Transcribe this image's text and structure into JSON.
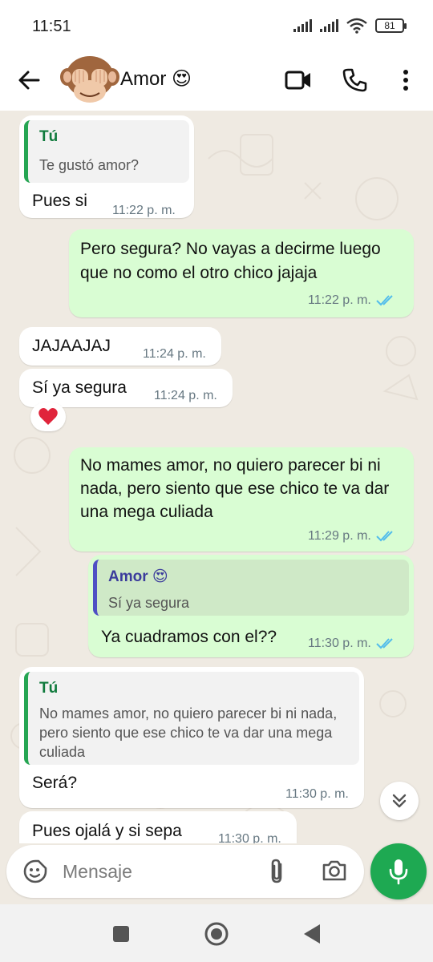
{
  "status_bar": {
    "time": "11:51",
    "battery": "81"
  },
  "header": {
    "contact_name": "Amor 😍"
  },
  "messages": [
    {
      "dir": "in",
      "quote_name": "Tú",
      "quote_text": "Te gustó amor?",
      "text": "Pues si",
      "time": "11:22 p. m."
    },
    {
      "dir": "out",
      "text": "Pero segura? No vayas a decirme luego que no como el otro chico jajaja",
      "time": "11:22 p. m.",
      "read": true
    },
    {
      "dir": "in",
      "text": "JAJAAJAJ",
      "time": "11:24 p. m."
    },
    {
      "dir": "in",
      "text": "Sí ya segura",
      "time": "11:24 p. m.",
      "reaction": "❤️"
    },
    {
      "dir": "out",
      "text": "No mames amor, no quiero parecer bi ni nada, pero siento que ese chico te va dar una mega culiada",
      "time": "11:29 p. m.",
      "read": true
    },
    {
      "dir": "out",
      "quote_name": "Amor 😍",
      "quote_text": "Sí ya segura",
      "text": "Ya cuadramos con el??",
      "time": "11:30 p. m.",
      "read": true
    },
    {
      "dir": "in",
      "quote_name": "Tú",
      "quote_text": "No mames amor, no quiero parecer bi ni nada, pero siento que ese chico te va dar una mega culiada",
      "text": "Será?",
      "time": "11:30 p. m."
    },
    {
      "dir": "in",
      "text": "Pues ojalá y si sepa",
      "time": "11:30 p. m."
    }
  ],
  "composer": {
    "placeholder": "Mensaje"
  },
  "colors": {
    "accent": "#1ea952",
    "outgoing_bubble": "#d9fdd3",
    "chat_bg": "#efeae2",
    "read_ticks": "#53bdeb"
  },
  "icons": [
    "back-arrow-icon",
    "video-call-icon",
    "phone-icon",
    "more-options-icon",
    "double-check-icon",
    "scroll-down-icon",
    "emoji-icon",
    "attach-icon",
    "camera-icon",
    "mic-icon",
    "nav-recents-icon",
    "nav-home-icon",
    "nav-back-icon"
  ]
}
